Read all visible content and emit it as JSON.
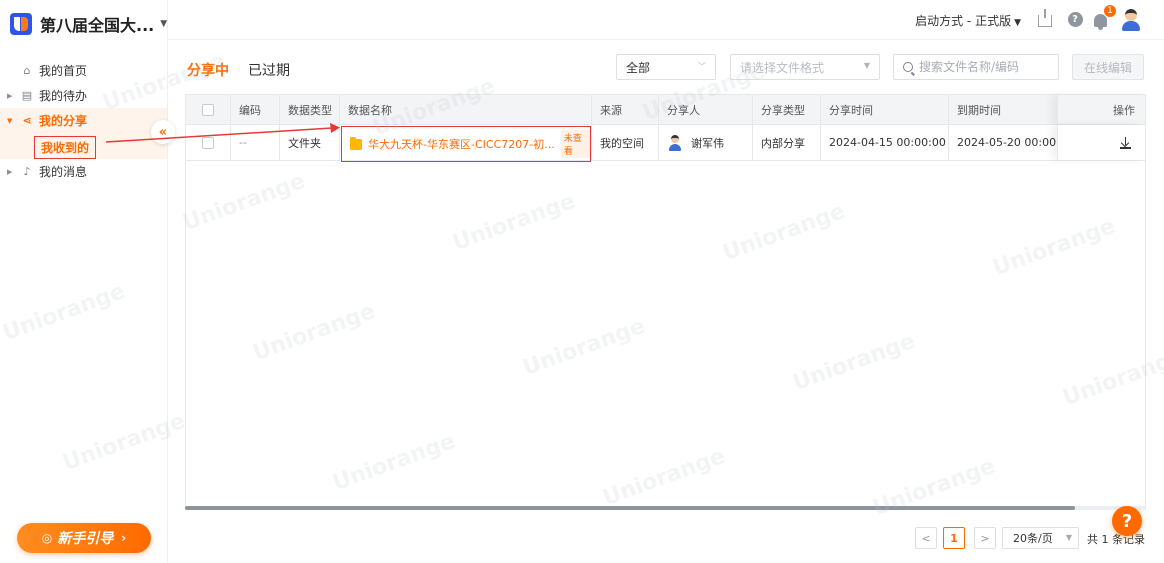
{
  "brand": {
    "name": "第八届全国大..."
  },
  "sidebar": {
    "items": [
      {
        "label": "我的首页",
        "icon": "home-icon"
      },
      {
        "label": "我的待办",
        "icon": "todo-icon"
      },
      {
        "label": "我的分享",
        "icon": "share-icon"
      },
      {
        "label": "我的消息",
        "icon": "bell-icon"
      }
    ],
    "sub_item": "我收到的",
    "guide_label": "新手引导"
  },
  "header": {
    "launch_label": "启动方式 - 正式版",
    "notification_count": "1"
  },
  "tabs": {
    "active": "分享中",
    "expired": "已过期"
  },
  "filters": {
    "type_value": "全部",
    "format_placeholder": "请选择文件格式",
    "search_placeholder": "搜索文件名称/编码",
    "edit_label": "在线编辑"
  },
  "table": {
    "columns": [
      "编码",
      "数据类型",
      "数据名称",
      "来源",
      "分享人",
      "分享类型",
      "分享时间",
      "到期时间",
      "操作"
    ],
    "rows": [
      {
        "code": "--",
        "data_type": "文件夹",
        "name": "华大九天杯-华东赛区-CICC7207-初...",
        "status": "未查看",
        "source": "我的空间",
        "sharer": "谢军伟",
        "share_type": "内部分享",
        "share_time": "2024-04-15 00:00:00",
        "expire_time": "2024-05-20 00:00:00"
      }
    ]
  },
  "pagination": {
    "prev": "<",
    "current_page": "1",
    "next": ">",
    "page_size": "20条/页",
    "total": "共 1 条记录"
  },
  "colors": {
    "accent": "#ff6a00",
    "annotation": "#e53935"
  },
  "watermark": "Uniorange"
}
